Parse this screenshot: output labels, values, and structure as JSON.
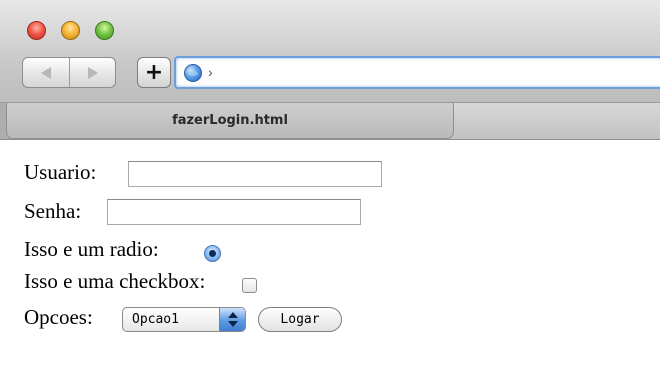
{
  "window": {
    "tab_title": "fazerLogin.html",
    "url_value": "›"
  },
  "form": {
    "usuario_label": "Usuario:",
    "usuario_value": "",
    "senha_label": "Senha:",
    "senha_value": "",
    "radio_label": "Isso e um radio:",
    "radio_checked": true,
    "checkbox_label": "Isso e uma checkbox:",
    "checkbox_checked": false,
    "opcoes_label": "Opcoes:",
    "opcoes_selected": "Opcao1",
    "logar_button": "Logar"
  },
  "icons": {
    "close": "close-icon",
    "minimize": "minimize-icon",
    "zoom": "zoom-icon",
    "back": "back-arrow-icon",
    "forward": "forward-arrow-icon",
    "add": "plus-icon",
    "site": "globe-icon"
  }
}
